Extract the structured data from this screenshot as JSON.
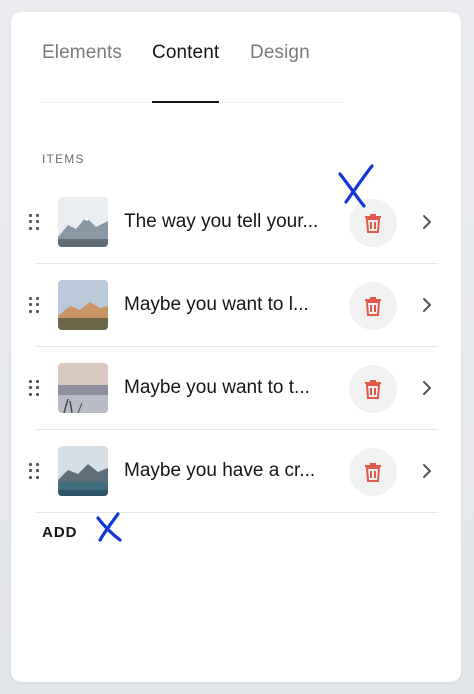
{
  "tabs": [
    {
      "label": "Elements",
      "active": false
    },
    {
      "label": "Content",
      "active": true
    },
    {
      "label": "Design",
      "active": false
    }
  ],
  "section_label": "ITEMS",
  "items": [
    {
      "title": "The way you tell your...",
      "thumbnail": "snowy-mountains"
    },
    {
      "title": "Maybe you want to l...",
      "thumbnail": "desert-mountains"
    },
    {
      "title": "Maybe you want to t...",
      "thumbnail": "lake-dusk"
    },
    {
      "title": "Maybe you have a cr...",
      "thumbnail": "mountain-lake"
    }
  ],
  "add_label": "ADD",
  "icons": {
    "drag": "drag-handle-icon",
    "delete": "trash-icon",
    "open": "chevron-right-icon"
  },
  "colors": {
    "trash": "#e05a4a",
    "annotation": "#1537d6",
    "active_tab_underline": "#151515"
  }
}
